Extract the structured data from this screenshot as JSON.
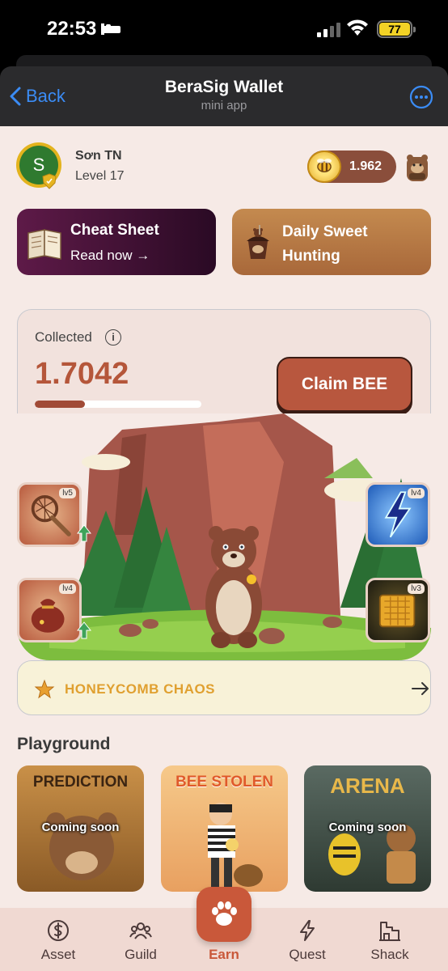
{
  "status_bar": {
    "time": "22:53",
    "battery": "77"
  },
  "nav": {
    "back_label": "Back",
    "title": "BeraSig Wallet",
    "subtitle": "mini app"
  },
  "profile": {
    "avatar_letter": "S",
    "name": "Sơn TN",
    "level": "Level 17"
  },
  "balance": {
    "value": "1.962"
  },
  "promos": {
    "cheat_sheet": {
      "title": "Cheat Sheet",
      "sub": "Read now →"
    },
    "daily_hunt": {
      "title_line1": "Daily Sweet",
      "title_line2": "Hunting"
    }
  },
  "collected": {
    "label": "Collected",
    "amount": "1.7042",
    "progress": 0.3,
    "claim_label": "Claim BEE"
  },
  "boosts": [
    {
      "level": "lv5",
      "icon": "net-icon"
    },
    {
      "level": "lv4",
      "icon": "sack-icon"
    },
    {
      "level": "lv4",
      "icon": "lightning-icon"
    },
    {
      "level": "lv3",
      "icon": "honeycomb-icon"
    }
  ],
  "event": {
    "label": "HONEYCOMB CHAOS"
  },
  "playground": {
    "title": "Playground",
    "cards": [
      {
        "banner": "PREDICTION",
        "status": "Coming soon"
      },
      {
        "banner": "BEE STOLEN",
        "status": ""
      },
      {
        "banner": "ARENA",
        "status": "Coming soon"
      }
    ]
  },
  "tabs": {
    "asset": "Asset",
    "guild": "Guild",
    "earn": "Earn",
    "quest": "Quest",
    "shack": "Shack"
  },
  "colors": {
    "accent": "#c9583a",
    "ios_blue": "#3b8cf5",
    "honey": "#e0a030"
  }
}
